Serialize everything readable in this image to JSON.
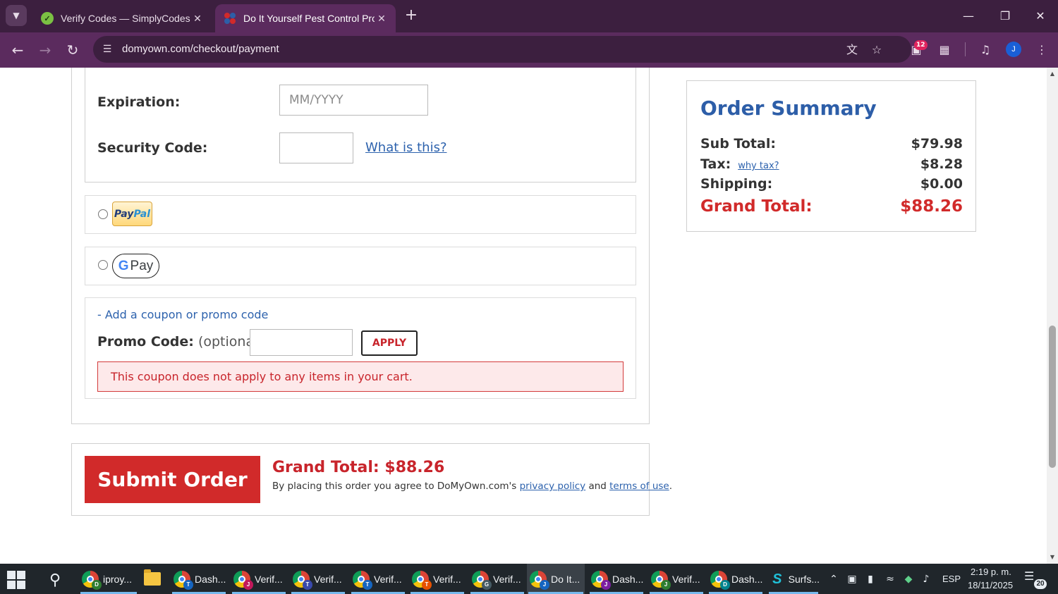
{
  "browser": {
    "tabs": [
      {
        "title": "Verify Codes — SimplyCodes",
        "active": false
      },
      {
        "title": "Do It Yourself Pest Control Prod",
        "active": true
      }
    ],
    "url": "domyown.com/checkout/payment",
    "extension_badge": "12",
    "profile_initial": "J"
  },
  "payment": {
    "expiration_label": "Expiration:",
    "expiration_placeholder": "MM/YYYY",
    "security_label": "Security Code:",
    "what_is_this": "What is this?",
    "paypal_pay": "Pay",
    "paypal_pal": "Pal",
    "gpay_g": "G",
    "gpay_text": "Pay"
  },
  "promo": {
    "toggle_link": "- Add a coupon or promo code",
    "label": "Promo Code:",
    "optional": "(optional)",
    "apply_label": "APPLY",
    "error": "This coupon does not apply to any items in your cart."
  },
  "submit": {
    "button_label": "Submit Order",
    "grand_total_line": "Grand Total: $88.26",
    "agree_prefix": "By placing this order you agree to DoMyOwn.com's",
    "privacy_link": "privacy policy",
    "agree_and": "and",
    "terms_link": "terms of use",
    "agree_suffix": "."
  },
  "order_summary": {
    "title": "Order Summary",
    "subtotal_label": "Sub Total:",
    "subtotal_value": "$79.98",
    "tax_label": "Tax:",
    "why_tax": "why tax?",
    "tax_value": "$8.28",
    "shipping_label": "Shipping:",
    "shipping_value": "$0.00",
    "grand_label": "Grand Total:",
    "grand_value": "$88.26"
  },
  "taskbar": {
    "apps": [
      {
        "label": "iproy...",
        "profile": "D",
        "profile_color": "#2e7d32"
      },
      {
        "label": "",
        "type": "folder"
      },
      {
        "label": "Dash...",
        "profile": "T",
        "profile_color": "#1565c0"
      },
      {
        "label": "Verif...",
        "profile": "J",
        "profile_color": "#c2185b"
      },
      {
        "label": "Verif...",
        "profile": "T",
        "profile_color": "#3949ab"
      },
      {
        "label": "Verif...",
        "profile": "T",
        "profile_color": "#1565c0"
      },
      {
        "label": "Verif...",
        "profile": "T",
        "profile_color": "#e65100"
      },
      {
        "label": "Verif...",
        "profile": "G",
        "profile_color": "#455a64"
      },
      {
        "label": "Do It...",
        "profile": "J",
        "profile_color": "#1565c0",
        "active": true
      },
      {
        "label": "Dash...",
        "profile": "J",
        "profile_color": "#7b1fa2"
      },
      {
        "label": "Verif...",
        "profile": "J",
        "profile_color": "#2e7d32"
      },
      {
        "label": "Dash...",
        "profile": "D",
        "profile_color": "#00838f"
      },
      {
        "label": "Surfs...",
        "type": "surfshark"
      }
    ],
    "language": "ESP",
    "time": "2:19 p. m.",
    "date": "18/11/2025",
    "notification_count": "20"
  }
}
